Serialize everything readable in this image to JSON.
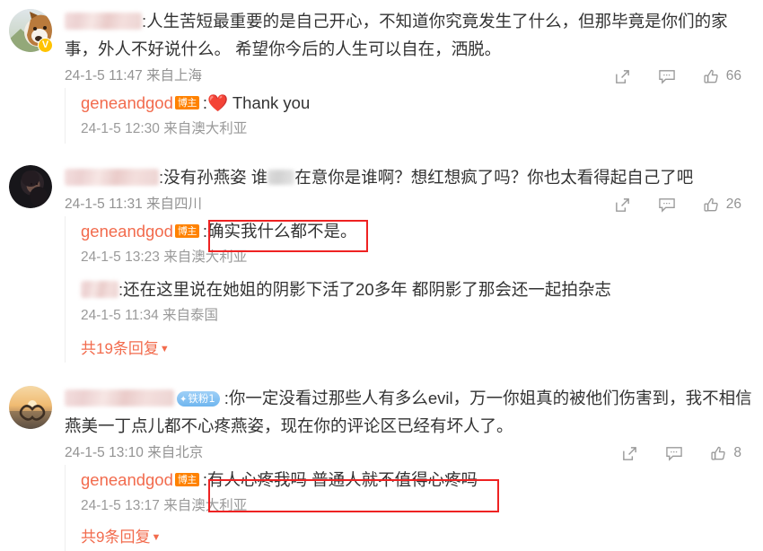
{
  "accent": {
    "blogger_name_color": "#F26B4D",
    "blogger_badge_bg": "#FF8200",
    "fan_badge_bg": "#6FB6EF",
    "verified_badge_bg": "#FFC300",
    "annotation_box_color": "#EE2222",
    "meta_text_color": "#939393"
  },
  "blogger": {
    "name": "geneandgod",
    "badge_label": "博主"
  },
  "icons": {
    "share": "share-icon",
    "comment": "comment-icon",
    "like": "like-icon",
    "verified": "V",
    "caret_down": "▼"
  },
  "comments": [
    {
      "avatar": "dog-avatar",
      "verified": true,
      "username_redacted": true,
      "text": ":人生苦短最重要的是自己开心，不知道你究竟发生了什么，但那毕竟是你们的家事，外人不好说什么。 希望你今后的人生可以自在，洒脱。",
      "time": "24-1-5 11:47 来自上海",
      "like_count": "66",
      "replies": [
        {
          "author": "geneandgod",
          "badge": "博主",
          "text": ":❤️ Thank you",
          "time": "24-1-5 12:30 来自澳大利亚",
          "highlighted": false
        }
      ],
      "more_replies": null
    },
    {
      "avatar": "woman-avatar",
      "verified": false,
      "username_redacted": true,
      "text_part1": ":没有孙燕姿 谁",
      "text_part2": "在意你是谁啊？想红想疯了吗？你也太看得起自己了吧",
      "time": "24-1-5 11:31 来自四川",
      "like_count": "26",
      "replies": [
        {
          "author": "geneandgod",
          "badge": "博主",
          "text": ":确实我什么都不是。",
          "time": "24-1-5 13:23 来自澳大利亚",
          "highlighted": true
        },
        {
          "author": null,
          "badge": null,
          "text": ":还在这里说在她姐的阴影下活了20多年 都阴影了那会还一起拍杂志",
          "time": "24-1-5 11:34 来自泰国",
          "highlighted": false
        }
      ],
      "more_replies": "共19条回复"
    },
    {
      "avatar": "sunset-heart-avatar",
      "verified": false,
      "username_redacted": true,
      "fan_badge": "铁粉1",
      "text": ":你一定没看过那些人有多么evil，万一你姐真的被他们伤害到，我不相信燕美一丁点儿都不心疼燕姿，现在你的评论区已经有坏人了。",
      "time": "24-1-5 13:10 来自北京",
      "like_count": "8",
      "replies": [
        {
          "author": "geneandgod",
          "badge": "博主",
          "text": ":有人心疼我吗 普通人就不值得心疼吗",
          "time": "24-1-5 13:17 来自澳大利亚",
          "highlighted": true
        }
      ],
      "more_replies": "共9条回复"
    }
  ]
}
